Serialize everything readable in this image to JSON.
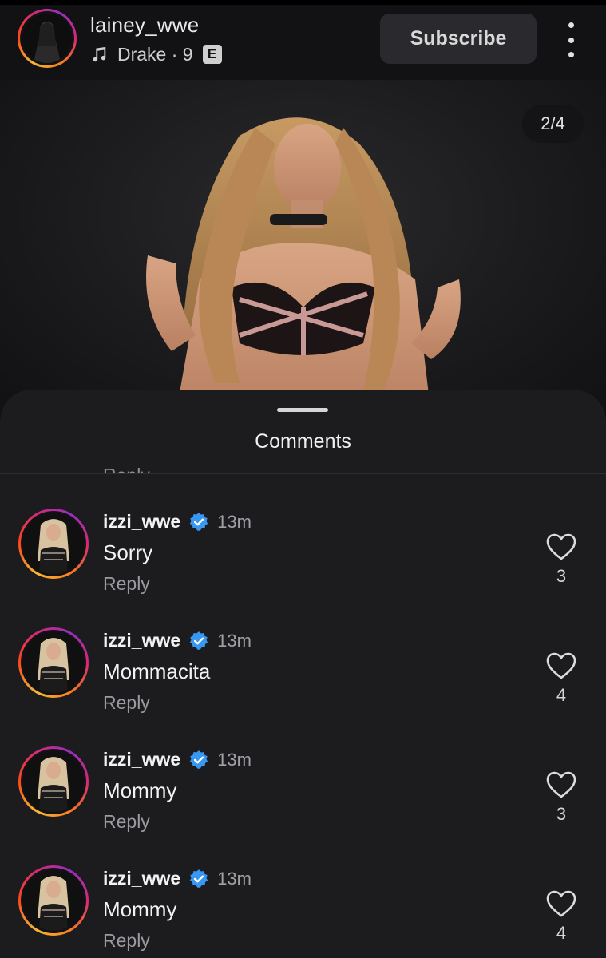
{
  "header": {
    "username": "lainey_wwe",
    "music_label": "Drake · 9",
    "explicit_badge": "E",
    "subscribe_label": "Subscribe"
  },
  "post": {
    "counter": "2/4"
  },
  "comments_sheet": {
    "title": "Comments",
    "partial_reply_label": "Reply",
    "comments": [
      {
        "username": "izzi_wwe",
        "time": "13m",
        "text": "Sorry",
        "reply_label": "Reply",
        "likes": "3"
      },
      {
        "username": "izzi_wwe",
        "time": "13m",
        "text": "Mommacita",
        "reply_label": "Reply",
        "likes": "4"
      },
      {
        "username": "izzi_wwe",
        "time": "13m",
        "text": "Mommy",
        "reply_label": "Reply",
        "likes": "3"
      },
      {
        "username": "izzi_wwe",
        "time": "13m",
        "text": "Mommy",
        "reply_label": "Reply",
        "likes": "4"
      }
    ]
  },
  "colors": {
    "verified": "#3897f0",
    "story_ring": [
      "#f7b733",
      "#d62976",
      "#962fbf"
    ]
  },
  "icons": [
    "music-note-icon",
    "more-vertical-icon",
    "verified-badge-icon",
    "heart-icon"
  ]
}
